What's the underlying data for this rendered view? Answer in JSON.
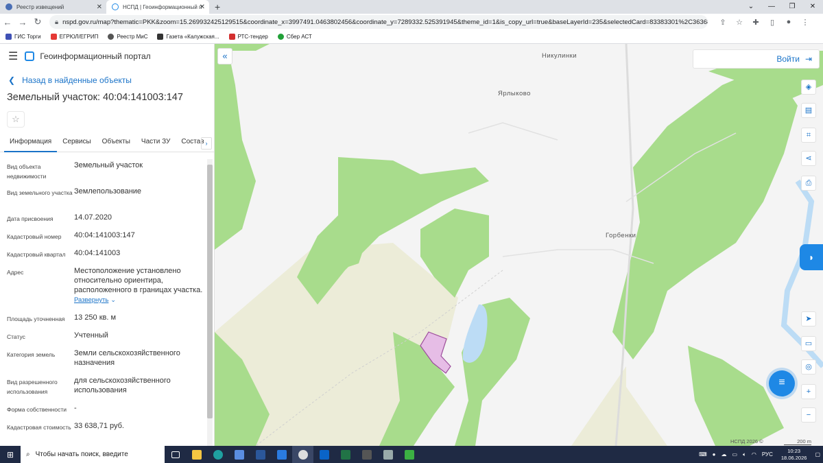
{
  "browser": {
    "tabs": [
      {
        "title": "Реестр извещений",
        "active": false
      },
      {
        "title": "НСПД | Геоинформационный п",
        "active": true
      }
    ],
    "new_tab": "+",
    "url": "nspd.gov.ru/map?thematic=PKK&zoom=15.269932425129515&coordinate_x=3997491.0463802456&coordinate_y=7289332.525391945&theme_id=1&is_copy_url=true&baseLayerId=235&selectedCard=83383301%2C36368%2C40%3A04%3A1410...",
    "bookmarks": [
      "ГИС Торги",
      "ЕГРЮЛ/ЕГРИП",
      "Реестр МиС",
      "Газета «Калужская...",
      "РТС-тендер",
      "Сбер АСТ"
    ]
  },
  "panel": {
    "app_title": "Геоинформационный портал",
    "back_label": "Назад в найденные объекты",
    "object_title": "Земельный участок: 40:04:141003:147",
    "tabs": [
      "Информация",
      "Сервисы",
      "Объекты",
      "Части ЗУ",
      "Состав"
    ],
    "expand_label": "Развернуть",
    "fields": [
      {
        "label": "Вид объекта недвижимости",
        "value": "Земельный участок"
      },
      {
        "label": "Вид земельного участка",
        "value": "Землепользование"
      },
      {
        "label": "Дата присвоения",
        "value": "14.07.2020"
      },
      {
        "label": "Кадастровый номер",
        "value": "40:04:141003:147"
      },
      {
        "label": "Кадастровый квартал",
        "value": "40:04:141003"
      },
      {
        "label": "Адрес",
        "value": "Местоположение установлено относительно ориентира, расположенного в границах участка."
      },
      {
        "label": "Площадь уточненная",
        "value": "13 250 кв. м"
      },
      {
        "label": "Статус",
        "value": "Учтенный"
      },
      {
        "label": "Категория земель",
        "value": "Земли сельскохозяйственного назначения"
      },
      {
        "label": "Вид разрешенного использования",
        "value": "для сельскохозяйственного использования"
      },
      {
        "label": "Форма собственности",
        "value": "-"
      },
      {
        "label": "Кадастровая стоимость",
        "value": "33 638,71 руб."
      }
    ]
  },
  "map": {
    "login_label": "Войти",
    "places": [
      "Никулинки",
      "Ярлыково",
      "Горбенки"
    ],
    "attribution": "НСПД 2026 ©",
    "scale": "200 m",
    "colors": {
      "forest": "#a8dc8c",
      "field": "#ececd8",
      "water": "#bcdcf5",
      "parcel": "#e6bde6"
    }
  },
  "taskbar": {
    "search_placeholder": "Чтобы начать поиск, введите",
    "lang": "РУС",
    "time": "10:23",
    "date": "18.06.2026"
  }
}
